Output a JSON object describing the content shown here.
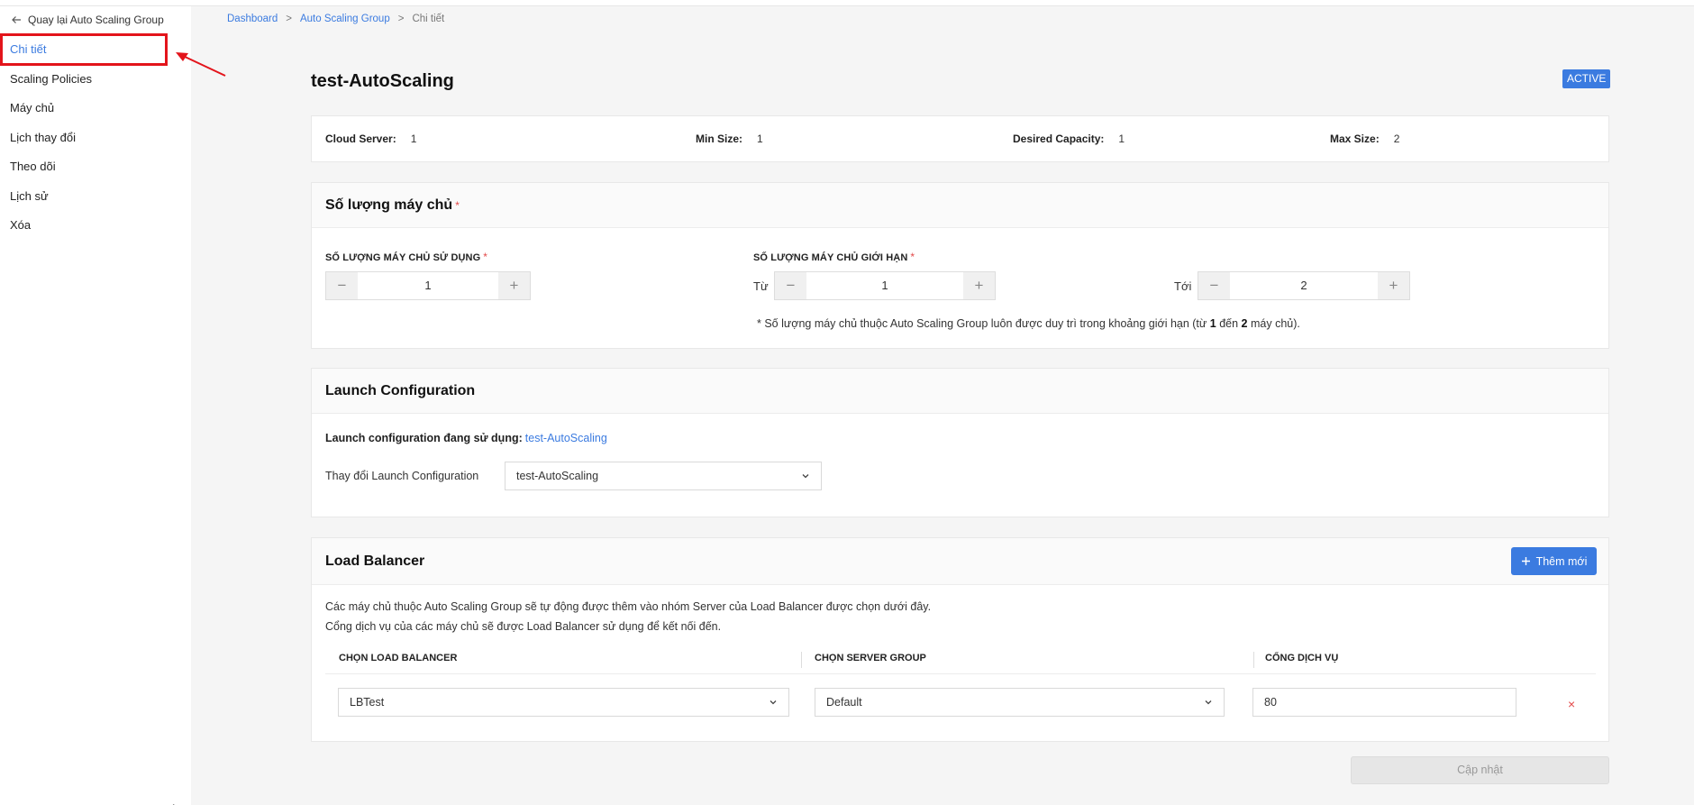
{
  "sidebar": {
    "back_label": "Quay lại Auto Scaling Group",
    "items": [
      {
        "label": "Chi tiết"
      },
      {
        "label": "Scaling Policies"
      },
      {
        "label": "Máy chủ"
      },
      {
        "label": "Lịch thay đổi"
      },
      {
        "label": "Theo dõi"
      },
      {
        "label": "Lịch sử"
      },
      {
        "label": "Xóa"
      }
    ],
    "active_index": 0
  },
  "breadcrumb": {
    "items": [
      "Dashboard",
      "Auto Scaling Group",
      "Chi tiết"
    ],
    "separator": ">"
  },
  "header": {
    "title": "test-AutoScaling",
    "status": "ACTIVE"
  },
  "summary": {
    "cloud_server_label": "Cloud Server:",
    "cloud_server_value": "1",
    "min_size_label": "Min Size:",
    "min_size_value": "1",
    "desired_label": "Desired Capacity:",
    "desired_value": "1",
    "max_size_label": "Max Size:",
    "max_size_value": "2"
  },
  "quantity": {
    "title": "Số lượng máy chủ",
    "required_mark": "*",
    "used_label": "SỐ LƯỢNG MÁY CHỦ SỬ DỤNG",
    "used_value": "1",
    "limit_label": "SỐ LƯỢNG MÁY CHỦ GIỚI HẠN",
    "from_label": "Từ",
    "from_value": "1",
    "to_label": "Tới",
    "to_value": "2",
    "note_prefix": "* Số lượng máy chủ thuộc Auto Scaling Group luôn được duy trì trong khoảng giới hạn (từ",
    "note_from": "1",
    "note_mid": "đến",
    "note_to": "2",
    "note_suffix": "máy chủ)."
  },
  "launch": {
    "title": "Launch Configuration",
    "using_label": "Launch configuration đang sử dụng:",
    "using_value": "test-AutoScaling",
    "change_label": "Thay đổi Launch Configuration",
    "selected": "test-AutoScaling"
  },
  "load_balancer": {
    "title": "Load Balancer",
    "add_label": "Thêm mới",
    "desc_line1": "Các máy chủ thuộc Auto Scaling Group sẽ tự động được thêm vào nhóm Server của Load Balancer được chọn dưới đây.",
    "desc_line2": "Cổng dịch vụ của các máy chủ sẽ được Load Balancer sử dụng để kết nối đến.",
    "columns": [
      "CHỌN LOAD BALANCER",
      "CHỌN SERVER GROUP",
      "CỔNG DỊCH VỤ"
    ],
    "row": {
      "load_balancer": "LBTest",
      "server_group": "Default",
      "port": "80",
      "remove": "×"
    }
  },
  "update_label": "Cập nhật",
  "colors": {
    "accent": "#3b7be0",
    "highlight": "#e3141b",
    "danger": "#e34949"
  },
  "icons": {
    "back": "arrow-left-icon",
    "minus": "minus-icon",
    "plus": "plus-icon",
    "dropdown": "chevron-down-icon",
    "remove": "close-icon"
  }
}
